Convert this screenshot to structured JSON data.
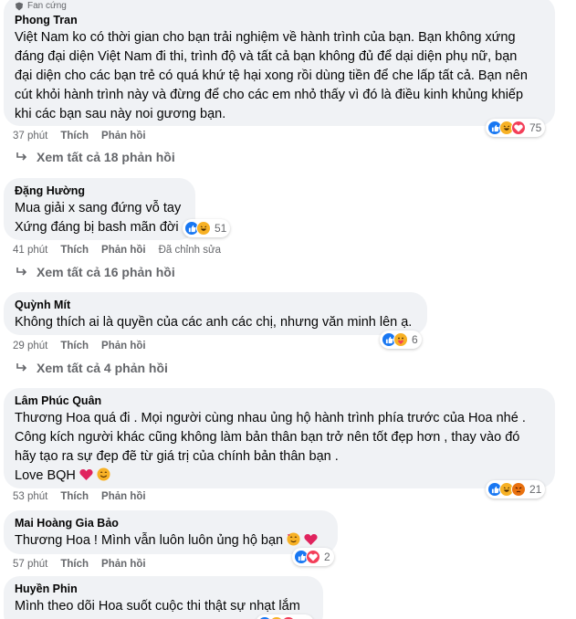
{
  "comments": [
    {
      "badge": "Fan cứng",
      "author": "Phong Tran",
      "lines": [
        "Việt Nam ko có thời gian cho bạn trải nghiệm về hành trình của bạn. Bạn không xứng",
        "đáng đại diện Việt Nam đi thi, trình độ và tất cả bạn không đủ để dại diện phụ nữ, bạn",
        "đại diện cho các bạn trẻ có quá khứ tệ hại xong rồi dùng tiền để che lấp tất cả. Bạn nên",
        "cút khỏi hành trình này và đừng để cho các em nhỏ thấy vì đó là điều kinh khủng khiếp",
        "khi các bạn sau này noi gương bạn."
      ],
      "time": "37 phút",
      "like": "Thích",
      "reply": "Phản hồi",
      "reactions": [
        "like",
        "haha",
        "love"
      ],
      "reaction_count": "75",
      "view_replies": "Xem tất cả 18 phản hồi"
    },
    {
      "author": "Đặng Hường",
      "lines": [
        "Mua giải x sang đứng vỗ tay",
        "Xứng đáng bị bash mãn đời"
      ],
      "time": "41 phút",
      "like": "Thích",
      "reply": "Phản hồi",
      "edited": "Đã chỉnh sửa",
      "reactions": [
        "like",
        "haha"
      ],
      "reaction_count": "51",
      "view_replies": "Xem tất cả 16 phản hồi"
    },
    {
      "author": "Quỳnh Mít",
      "lines": [
        "Không thích ai là quyền của các anh các chị, nhưng văn minh lên ạ."
      ],
      "time": "29 phút",
      "like": "Thích",
      "reply": "Phản hồi",
      "reactions": [
        "like",
        "care"
      ],
      "reaction_count": "6",
      "view_replies": "Xem tất cả 4 phản hồi"
    },
    {
      "author": "Lâm Phúc Quân",
      "lines": [
        "Thương Hoa quá đi . Mọi người cùng nhau ủng hộ hành trình phía trước của Hoa nhé .",
        "Công kích người khác cũng không làm bản thân bạn trở nên tốt đẹp hơn , thay vào đó",
        "hãy tạo ra sự đẹp đẽ từ giá trị của chính bản thân bạn .",
        "Love BQH"
      ],
      "time": "53 phút",
      "like": "Thích",
      "reply": "Phản hồi",
      "reactions": [
        "like",
        "haha",
        "angry"
      ],
      "reaction_count": "21"
    },
    {
      "author": "Mai Hoàng Gia Bảo",
      "lines": [
        "Thương Hoa ! Mình vẫn luôn luôn ủng hộ bạn"
      ],
      "time": "57 phút",
      "like": "Thích",
      "reply": "Phản hồi",
      "reactions": [
        "like",
        "love"
      ],
      "reaction_count": "2"
    },
    {
      "author": "Huyền Phin",
      "lines": [
        "Mình theo dõi Hoa suốt cuộc thi thật sự nhạt lắm"
      ]
    }
  ]
}
